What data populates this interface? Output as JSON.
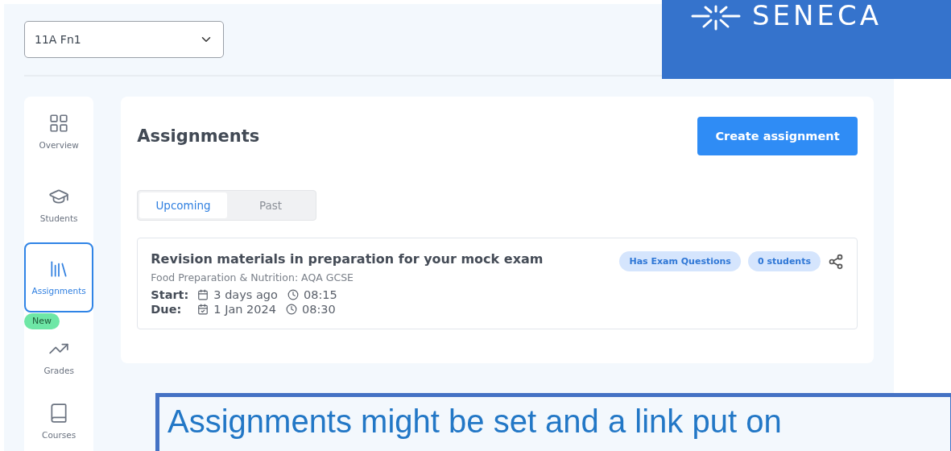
{
  "class_select": {
    "value": "11A Fn1"
  },
  "logo": {
    "text": "SENECA"
  },
  "sidebar": {
    "items": [
      {
        "label": "Overview",
        "selected": false
      },
      {
        "label": "Students",
        "selected": false
      },
      {
        "label": "Assignments",
        "selected": true
      },
      {
        "label": "Grades",
        "selected": false,
        "badge": "New"
      },
      {
        "label": "Courses",
        "selected": false
      }
    ]
  },
  "page": {
    "title": "Assignments",
    "create_button": "Create assignment",
    "tabs": [
      {
        "label": "Upcoming",
        "selected": true
      },
      {
        "label": "Past",
        "selected": false
      }
    ],
    "assignments": [
      {
        "title": "Revision materials in preparation for your mock exam",
        "course": "Food Preparation & Nutrition: AQA GCSE",
        "start_label": "Start:",
        "start_date": "3 days ago",
        "start_time": "08:15",
        "due_label": "Due:",
        "due_date": "1 Jan 2024",
        "due_time": "08:30",
        "tags": [
          "Has Exam Questions",
          "0 students"
        ]
      }
    ]
  },
  "callout": {
    "text": "Assignments might be set and a link put on"
  }
}
